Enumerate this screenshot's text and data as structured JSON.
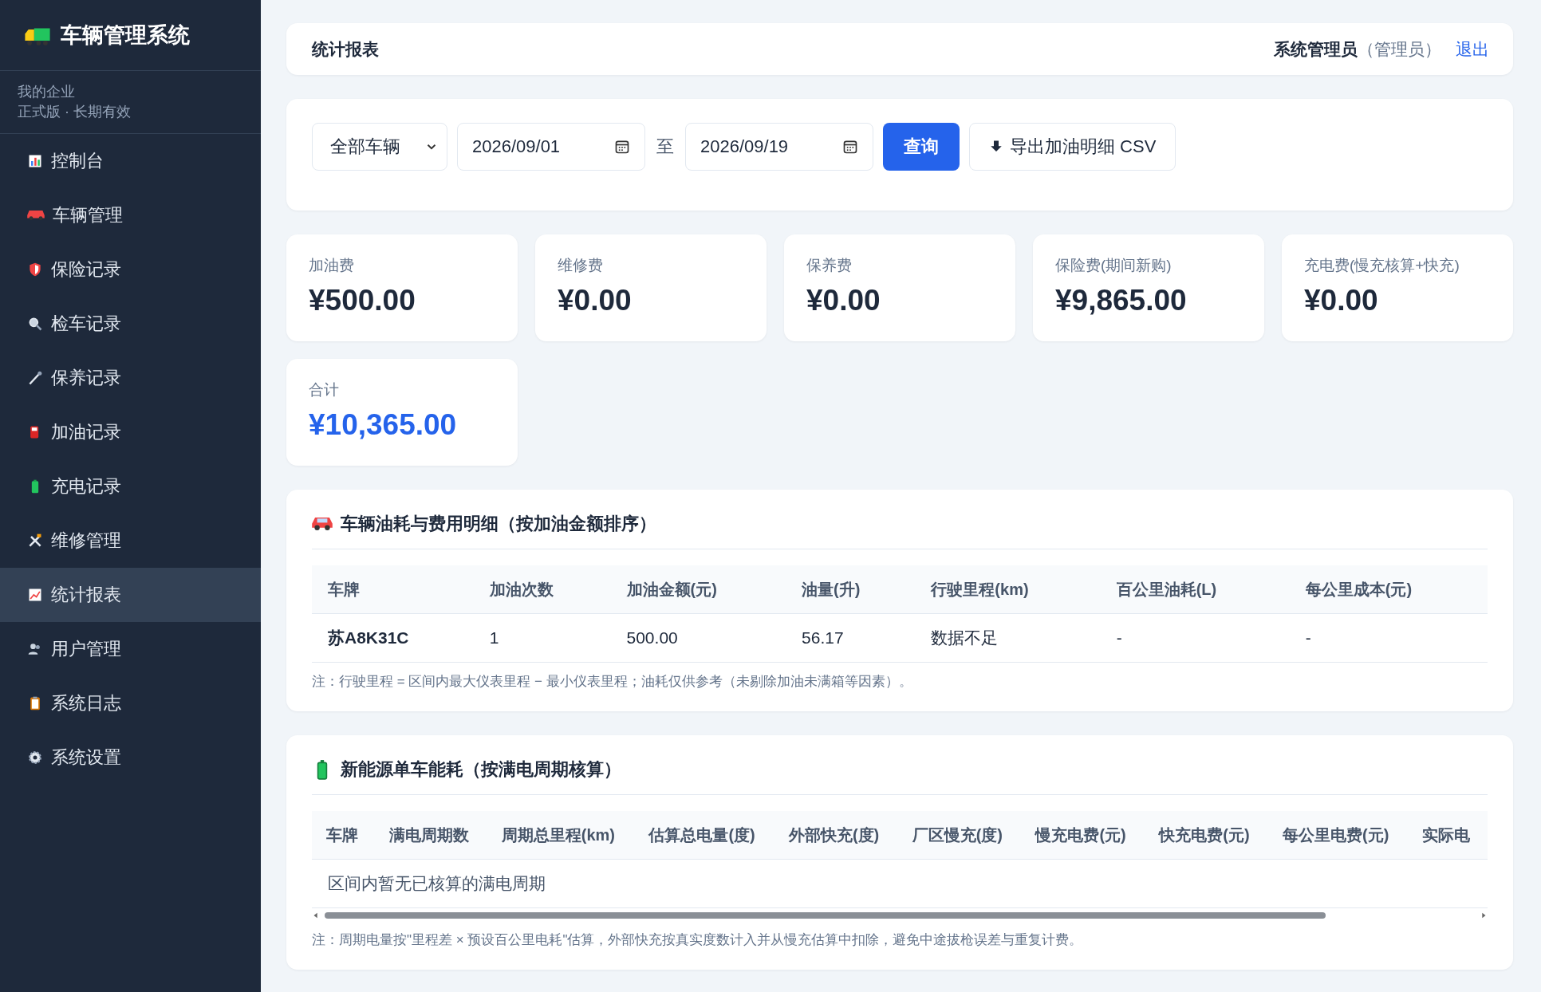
{
  "sidebar": {
    "title": "车辆管理系统",
    "org": "我的企业",
    "license": "正式版 · 长期有效",
    "items": [
      {
        "label": "控制台",
        "selected": false
      },
      {
        "label": "车辆管理",
        "selected": false
      },
      {
        "label": "保险记录",
        "selected": false
      },
      {
        "label": "检车记录",
        "selected": false
      },
      {
        "label": "保养记录",
        "selected": false
      },
      {
        "label": "加油记录",
        "selected": false
      },
      {
        "label": "充电记录",
        "selected": false
      },
      {
        "label": "维修管理",
        "selected": false
      },
      {
        "label": "统计报表",
        "selected": true
      },
      {
        "label": "用户管理",
        "selected": false
      },
      {
        "label": "系统日志",
        "selected": false
      },
      {
        "label": "系统设置",
        "selected": false
      }
    ]
  },
  "header": {
    "title": "统计报表",
    "user": "系统管理员",
    "role": "（管理员）",
    "logout": "退出"
  },
  "filters": {
    "vehicle": "全部车辆",
    "start_date": "2026/09/01",
    "separator": "至",
    "end_date": "2026/09/19",
    "query_button": "查询",
    "export_button": "导出加油明细 CSV"
  },
  "stats": [
    {
      "label": "加油费",
      "value": "¥500.00",
      "highlight": false
    },
    {
      "label": "维修费",
      "value": "¥0.00",
      "highlight": false
    },
    {
      "label": "保养费",
      "value": "¥0.00",
      "highlight": false
    },
    {
      "label": "保险费(期间新购)",
      "value": "¥9,865.00",
      "highlight": false
    },
    {
      "label": "充电费(慢充核算+快充)",
      "value": "¥0.00",
      "highlight": false
    },
    {
      "label": "合计",
      "value": "¥10,365.00",
      "highlight": true
    }
  ],
  "fuel_table": {
    "title": "车辆油耗与费用明细（按加油金额排序）",
    "columns": [
      "车牌",
      "加油次数",
      "加油金额(元)",
      "油量(升)",
      "行驶里程(km)",
      "百公里油耗(L)",
      "每公里成本(元)"
    ],
    "rows": [
      [
        "苏A8K31C",
        "1",
        "500.00",
        "56.17",
        "数据不足",
        "-",
        "-"
      ]
    ],
    "note": "注：行驶里程 = 区间内最大仪表里程 − 最小仪表里程；油耗仅供参考（未剔除加油未满箱等因素）。"
  },
  "ev_table": {
    "title": "新能源单车能耗（按满电周期核算）",
    "columns": [
      "车牌",
      "满电周期数",
      "周期总里程(km)",
      "估算总电量(度)",
      "外部快充(度)",
      "厂区慢充(度)",
      "慢充电费(元)",
      "快充电费(元)",
      "每公里电费(元)",
      "实际电"
    ],
    "empty": "区间内暂无已核算的满电周期",
    "note": "注：周期电量按\"里程差 × 预设百公里电耗\"估算，外部快充按真实度数计入并从慢充估算中扣除，避免中途拔枪误差与重复计费。"
  }
}
